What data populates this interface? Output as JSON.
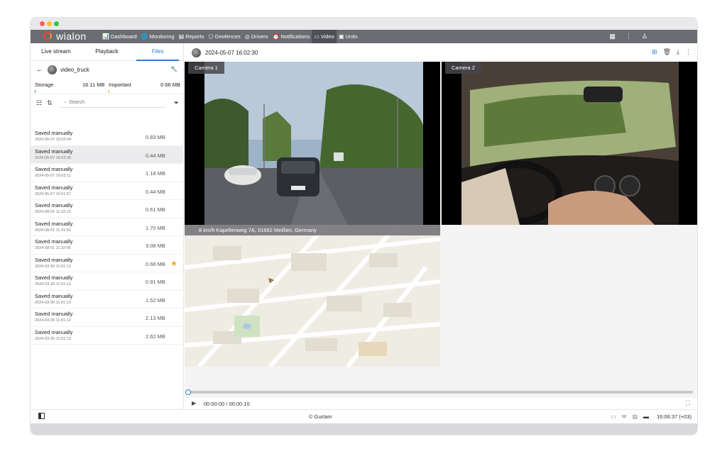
{
  "nav": {
    "logo": "wialon",
    "items": [
      {
        "icon": "chart-icon",
        "glyph": "📊",
        "label": "Dashboard"
      },
      {
        "icon": "globe-icon",
        "glyph": "🌐",
        "label": "Monitoring"
      },
      {
        "icon": "report-icon",
        "glyph": "▤",
        "label": "Reports"
      },
      {
        "icon": "geofence-icon",
        "glyph": "⬡",
        "label": "Geofences"
      },
      {
        "icon": "steering-icon",
        "glyph": "◎",
        "label": "Drivers"
      },
      {
        "icon": "alarm-icon",
        "glyph": "⏰",
        "label": "Notifications"
      },
      {
        "icon": "video-icon",
        "glyph": "▭",
        "label": "Video"
      },
      {
        "icon": "bus-icon",
        "glyph": "▣",
        "label": "Units"
      }
    ],
    "active_index": 6
  },
  "sidebar": {
    "tabs": [
      "Live stream",
      "Playback",
      "Files"
    ],
    "active_tab": 2,
    "unit_name": "video_truck",
    "storage_label": "Storage",
    "storage_value": "16.11 MB",
    "important_label": "Important",
    "important_value": "0.66 MB",
    "search_placeholder": "Search",
    "files": [
      {
        "name": "Saved manually",
        "date": "2024-05-07 16:02:44",
        "size": "0.83 MB",
        "starred": false
      },
      {
        "name": "Saved manually",
        "date": "2024-05-07 16:02:30",
        "size": "0.44 MB",
        "starred": false,
        "selected": true
      },
      {
        "name": "Saved manually",
        "date": "2024-05-07 15:03:11",
        "size": "1.18 MB",
        "starred": false
      },
      {
        "name": "Saved manually",
        "date": "2024-05-07 15:01:57",
        "size": "0.44 MB",
        "starred": false
      },
      {
        "name": "Saved manually",
        "date": "2024-08-01 11:32:13",
        "size": "0.61 MB",
        "starred": false
      },
      {
        "name": "Saved manually",
        "date": "2024-08-01 11:31:59",
        "size": "1.70 MB",
        "starred": false
      },
      {
        "name": "Saved manually",
        "date": "2024-08-01 11:32:06",
        "size": "3.08 MB",
        "starred": false
      },
      {
        "name": "Saved manually",
        "date": "2024-03-30 11:01:13",
        "size": "0.66 MB",
        "starred": true
      },
      {
        "name": "Saved manually",
        "date": "2024-03-30 11:01:13",
        "size": "0.91 MB",
        "starred": false
      },
      {
        "name": "Saved manually",
        "date": "2024-03-30 11:01:13",
        "size": "1.52 MB",
        "starred": false
      },
      {
        "name": "Saved manually",
        "date": "2024-03-30 11:01:13",
        "size": "2.13 MB",
        "starred": false
      },
      {
        "name": "Saved manually",
        "date": "2024-03-30 11:01:13",
        "size": "2.62 MB",
        "starred": false
      }
    ]
  },
  "main": {
    "file_title": "2024-05-07 16:02:30",
    "camera1_label": "Camera 1",
    "camera2_label": "Camera 2",
    "map_info": "8 km/h Kapellenweg 7A, 01662 Meißen, Germany",
    "progress": 0,
    "time": "00:00:00 / 00:00:10"
  },
  "footer": {
    "copyright": "© Gurtam",
    "clock": "16:06:37 (+03)"
  },
  "colors": {
    "accent": "#2b7fd4",
    "navbar": "#6b6d72",
    "star": "#f5a623"
  }
}
